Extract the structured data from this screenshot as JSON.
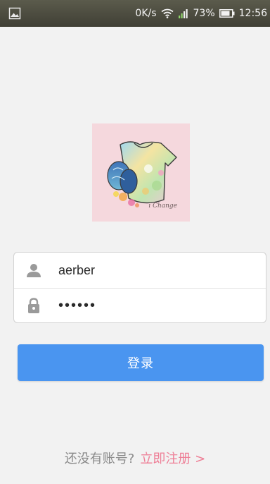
{
  "status_bar": {
    "network_speed": "0K/s",
    "battery_percent": "73%",
    "time": "12:56",
    "icons": [
      "image-notification-icon",
      "wifi-icon",
      "signal-icon",
      "battery-icon"
    ]
  },
  "logo": {
    "caption": "i Change",
    "background_color": "#f5d8dd"
  },
  "form": {
    "username_value": "aerber",
    "password_value": "••••••",
    "username_icon": "user-icon",
    "password_icon": "lock-icon"
  },
  "login_button": {
    "label": "登录",
    "color": "#4a95f0"
  },
  "footer": {
    "prompt": "还没有账号?",
    "register_link": "立即注册 >",
    "link_color": "#ee7e96"
  }
}
